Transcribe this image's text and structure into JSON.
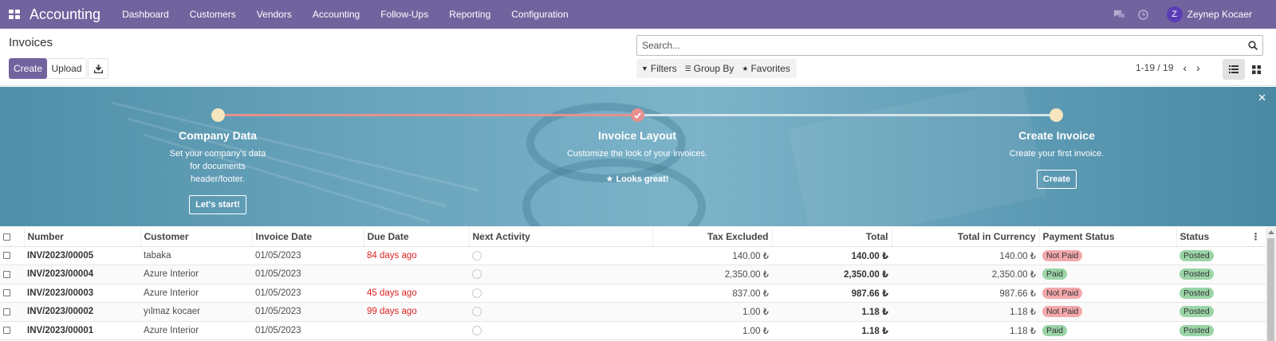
{
  "navbar": {
    "brand": "Accounting",
    "menu": [
      "Dashboard",
      "Customers",
      "Vendors",
      "Accounting",
      "Follow-Ups",
      "Reporting",
      "Configuration"
    ],
    "user_initial": "Z",
    "user_name": "Zeynep Kocaer"
  },
  "control_panel": {
    "breadcrumb": "Invoices",
    "create_label": "Create",
    "upload_label": "Upload",
    "search_placeholder": "Search...",
    "filters_label": "Filters",
    "groupby_label": "Group By",
    "favorites_label": "Favorites",
    "pager": "1-19 / 19"
  },
  "onboarding": {
    "steps": [
      {
        "title": "Company Data",
        "desc": "Set your company's data for documents header/footer.",
        "button": "Let's start!"
      },
      {
        "title": "Invoice Layout",
        "desc": "Customize the look of your invoices.",
        "done": "Looks great!"
      },
      {
        "title": "Create Invoice",
        "desc": "Create your first invoice.",
        "button": "Create"
      }
    ]
  },
  "table": {
    "headers": [
      "Number",
      "Customer",
      "Invoice Date",
      "Due Date",
      "Next Activity",
      "Tax Excluded",
      "Total",
      "Total in Currency",
      "Payment Status",
      "Status"
    ],
    "rows": [
      {
        "number": "INV/2023/00005",
        "customer": "tabaka",
        "invoice_date": "01/05/2023",
        "due_date": "84 days ago",
        "tax_excluded": "140.00 ₺",
        "total": "140.00 ₺",
        "total_currency": "140.00 ₺",
        "payment_status": "Not Paid",
        "status": "Posted"
      },
      {
        "number": "INV/2023/00004",
        "customer": "Azure Interior",
        "invoice_date": "01/05/2023",
        "due_date": "",
        "tax_excluded": "2,350.00 ₺",
        "total": "2,350.00 ₺",
        "total_currency": "2,350.00 ₺",
        "payment_status": "Paid",
        "status": "Posted"
      },
      {
        "number": "INV/2023/00003",
        "customer": "Azure Interior",
        "invoice_date": "01/05/2023",
        "due_date": "45 days ago",
        "tax_excluded": "837.00 ₺",
        "total": "987.66 ₺",
        "total_currency": "987.66 ₺",
        "payment_status": "Not Paid",
        "status": "Posted"
      },
      {
        "number": "INV/2023/00002",
        "customer": "yılmaz kocaer",
        "invoice_date": "01/05/2023",
        "due_date": "99 days ago",
        "tax_excluded": "1.00 ₺",
        "total": "1.18 ₺",
        "total_currency": "1.18 ₺",
        "payment_status": "Not Paid",
        "status": "Posted"
      },
      {
        "number": "INV/2023/00001",
        "customer": "Azure Interior",
        "invoice_date": "01/05/2023",
        "due_date": "",
        "tax_excluded": "1.00 ₺",
        "total": "1.18 ₺",
        "total_currency": "1.18 ₺",
        "payment_status": "Paid",
        "status": "Posted"
      }
    ]
  },
  "colors": {
    "brand": "#71639e",
    "overdue": "#dd2222",
    "not_paid_badge": "#f3a8ab",
    "paid_badge": "#9bd4a6"
  }
}
